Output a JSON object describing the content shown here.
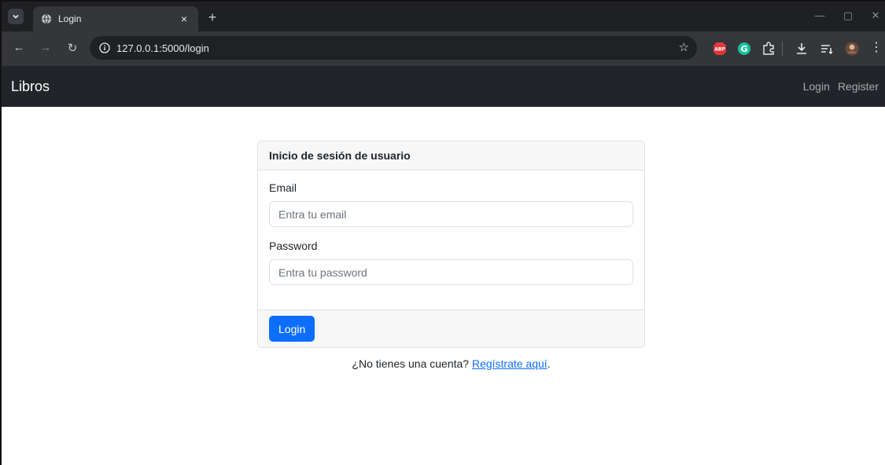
{
  "browser": {
    "tab_title": "Login",
    "tab_close": "×",
    "new_tab": "+",
    "url": "127.0.0.1:5000/login",
    "extensions": [
      "adblock-icon",
      "grammarly-icon",
      "puzzle-icon",
      "download-icon",
      "reading-list-icon",
      "profile-avatar",
      "more-menu-icon"
    ]
  },
  "app": {
    "brand": "Libros",
    "nav": {
      "login": "Login",
      "register": "Register"
    }
  },
  "login_form": {
    "title": "Inicio de sesión de usuario",
    "email_label": "Email",
    "email_placeholder": "Entra tu email",
    "email_value": "",
    "password_label": "Password",
    "password_placeholder": "Entra tu password",
    "password_value": "",
    "submit_label": "Login"
  },
  "footer": {
    "prompt": "¿No tienes una cuenta? ",
    "link_text": "Regístrate aquí",
    "suffix": "."
  },
  "colors": {
    "primary": "#0d6efd",
    "navbar": "#212529",
    "chrome_dark": "#1f2024"
  }
}
